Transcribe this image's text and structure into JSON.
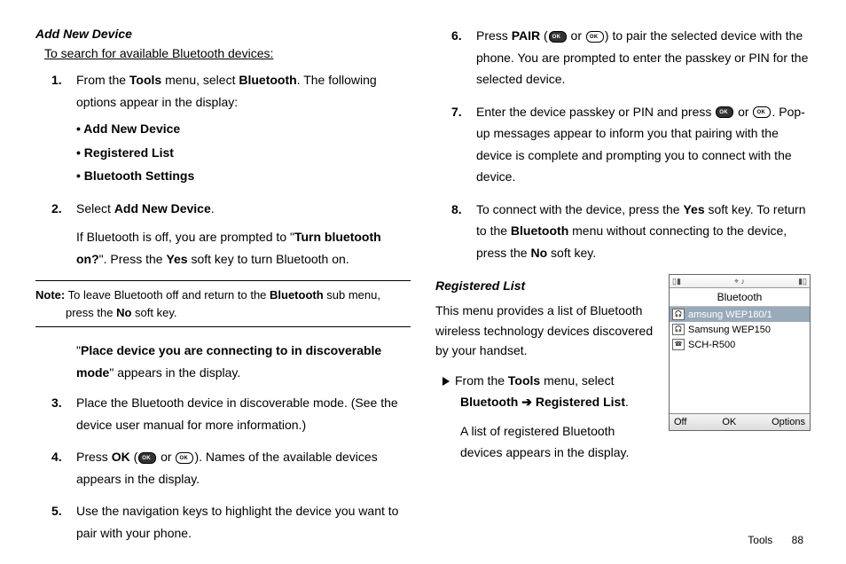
{
  "left": {
    "heading": "Add New Device",
    "intro": "To search for available Bluetooth devices:",
    "step1_a": "From the ",
    "step1_b": "Tools",
    "step1_c": " menu, select ",
    "step1_d": "Bluetooth",
    "step1_e": ". The following options appear in the display:",
    "bullets": {
      "b1": "• Add New Device",
      "b2": "• Registered List",
      "b3": "• Bluetooth Settings"
    },
    "step2_a": "Select ",
    "step2_b": "Add New Device",
    "step2_c": ".",
    "step2_d": "If Bluetooth is off, you are prompted to \"",
    "step2_e": "Turn bluetooth on?",
    "step2_f": "\". Press the ",
    "step2_g": "Yes",
    "step2_h": " soft key to turn Bluetooth on.",
    "note_label": "Note:",
    "note_a": " To leave Bluetooth off and return to the ",
    "note_b": "Bluetooth",
    "note_c": " sub menu, press the ",
    "note_d": "No",
    "note_e": " soft key.",
    "after_a": "\"",
    "after_b": "Place device you are connecting to in discoverable mode",
    "after_c": "\" appears in the display.",
    "step3": "Place the Bluetooth device in discoverable mode. (See the device user manual for more information.)",
    "step4_a": "Press ",
    "step4_b": "OK",
    "step4_c": " (",
    "step4_d": " or ",
    "step4_e": "). Names of the available devices appears in the display.",
    "step5": "Use the navigation keys to highlight the device you want to pair with your phone."
  },
  "right": {
    "step6_a": "Press ",
    "step6_b": "PAIR",
    "step6_c": " (",
    "step6_d": " or ",
    "step6_e": ") to pair the selected device with the phone. You are prompted to enter the passkey or PIN for the selected device.",
    "step7_a": "Enter the device passkey or PIN and press ",
    "step7_b": " or ",
    "step7_c": ". Pop-up messages appear to inform you that pairing with the device is complete and prompting you to connect with the device.",
    "step8_a": "To connect with the device, press the ",
    "step8_b": "Yes",
    "step8_c": " soft key. To return to the ",
    "step8_d": "Bluetooth",
    "step8_e": " menu without connecting to the device, press the ",
    "step8_f": "No",
    "step8_g": " soft key.",
    "heading2": "Registered List",
    "reg_intro": "This menu provides a list of Bluetooth wireless technology devices discovered by your handset.",
    "reg_a": "From the ",
    "reg_b": "Tools",
    "reg_c": " menu, select ",
    "reg_d": "Bluetooth",
    "reg_e": " ➔ ",
    "reg_f": "Registered List",
    "reg_g": ".",
    "reg_h": "A list of registered Bluetooth devices appears in the display."
  },
  "phone": {
    "title": "Bluetooth",
    "row1": "amsung WEP180/1",
    "row2": "Samsung WEP150",
    "row3": "SCH-R500",
    "soft_left": "Off",
    "soft_mid": "OK",
    "soft_right": "Options"
  },
  "footer": {
    "section": "Tools",
    "page": "88"
  },
  "nums": {
    "n1": "1.",
    "n2": "2.",
    "n3": "3.",
    "n4": "4.",
    "n5": "5.",
    "n6": "6.",
    "n7": "7.",
    "n8": "8."
  }
}
